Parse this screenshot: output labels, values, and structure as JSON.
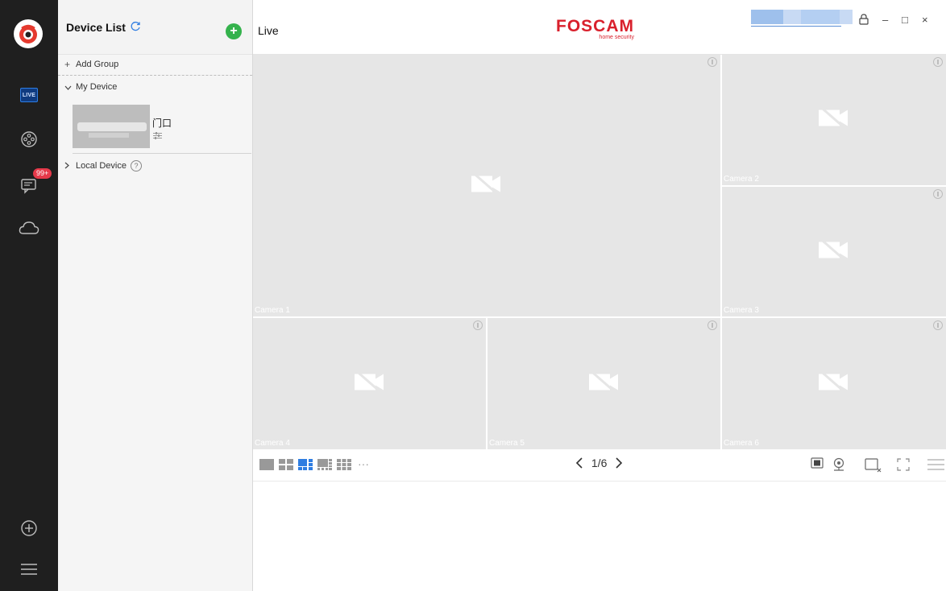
{
  "app": {
    "brand": "FOSCAM",
    "brand_sub": "home security"
  },
  "panel": {
    "title": "Device List",
    "add_group": "Add Group",
    "my_device": "My Device",
    "device_name": "门口",
    "local_device": "Local Device",
    "help_mark": "?"
  },
  "topbar": {
    "title": "Live",
    "minimize": "–",
    "maximize": "□",
    "close": "×"
  },
  "rail": {
    "live_label": "LIVE",
    "messages_badge": "99+"
  },
  "cameras": [
    {
      "label": "Camera 1"
    },
    {
      "label": "Camera 2"
    },
    {
      "label": "Camera 3"
    },
    {
      "label": "Camera 4"
    },
    {
      "label": "Camera 5"
    },
    {
      "label": "Camera 6"
    }
  ],
  "toolbar": {
    "page": "1/6",
    "more": "···",
    "selected_layout": "1+5"
  },
  "colors": {
    "accent": "#2f7de1",
    "brand_red": "#d9202c",
    "add_green": "#34b24c",
    "badge_red": "#e6394a",
    "rail_bg": "#1f1f1f"
  }
}
